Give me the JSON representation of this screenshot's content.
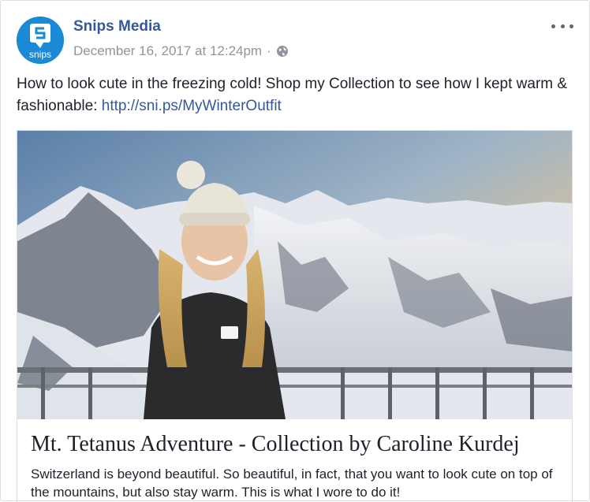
{
  "post": {
    "page_name": "Snips Media",
    "avatar_text": "snips",
    "timestamp": "December 16, 2017 at 12:24pm",
    "separator": "·",
    "privacy_icon": "globe-icon",
    "more_icon": "more-options-icon",
    "text_main": "How to look cute in the freezing cold! Shop my Collection to see how I kept warm & fashionable: ",
    "link": "http://sni.ps/MyWinterOutfit"
  },
  "card": {
    "title": "Mt. Tetanus Adventure - Collection by Caroline Kurdej",
    "description": "Switzerland is beyond beautiful. So beautiful, in fact, that you want to look cute on top of the mountains, but also stay warm. This is what I wore to do it!"
  },
  "colors": {
    "link": "#365899",
    "meta": "#90949c",
    "avatar": "#1b8ad6"
  }
}
